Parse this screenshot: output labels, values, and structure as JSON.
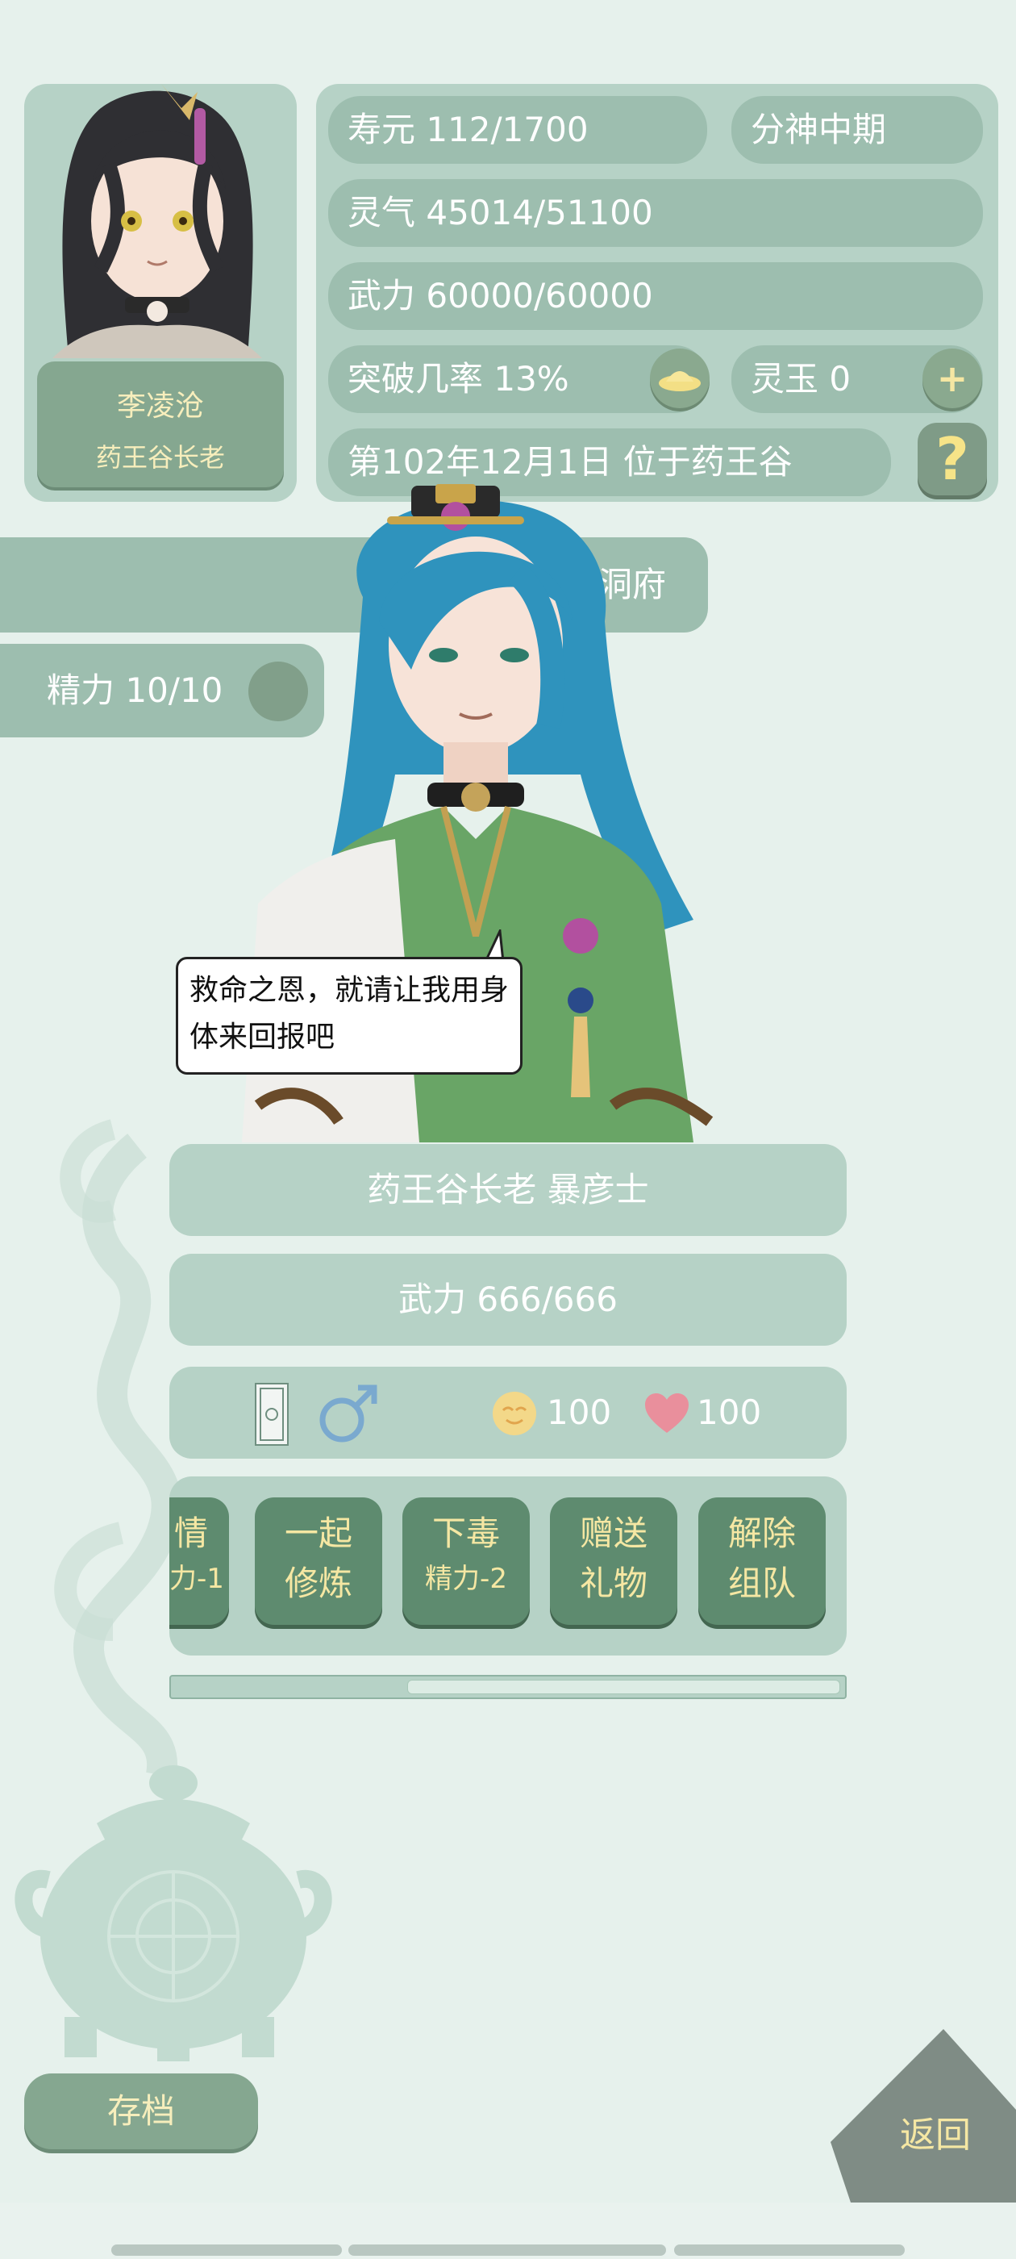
{
  "player": {
    "name": "李凌沧",
    "title": "药王谷长老"
  },
  "stats": {
    "lifespan": "寿元 112/1700",
    "realm": "分神中期",
    "spirit": "灵气 45014/51100",
    "force": "武力 60000/60000",
    "breakthrough": "突破几率 13%",
    "jade": "灵玉 0",
    "date_location": "第102年12月1日 位于药王谷",
    "help_label": "?"
  },
  "side_tabs": {
    "cave_label": "洞府",
    "energy_label": "精力 10/10"
  },
  "npc": {
    "speech": "救命之恩，就请让我用身体来回报吧",
    "title_name": "药王谷长老 暴彦士",
    "force": "武力 666/666",
    "mood": "100",
    "affection": "100"
  },
  "actions": [
    {
      "line1": "情",
      "line2": "力-1"
    },
    {
      "line1": "一起",
      "line2": "修炼"
    },
    {
      "line1": "下毒",
      "line2": "精力-2"
    },
    {
      "line1": "赠送",
      "line2": "礼物"
    },
    {
      "line1": "解除",
      "line2": "组队"
    }
  ],
  "action_scroll_fraction": 0.4,
  "footer": {
    "save_label": "存档",
    "back_label": "返回"
  },
  "colors": {
    "background": "#e6f1ec",
    "panel": "#b6d2c6",
    "pill": "#9dbeaf",
    "button_dark": "#5e8b6f",
    "gold_text": "#f5e7a3",
    "male_icon": "#7aa9cf",
    "heart": "#e98f9c"
  }
}
